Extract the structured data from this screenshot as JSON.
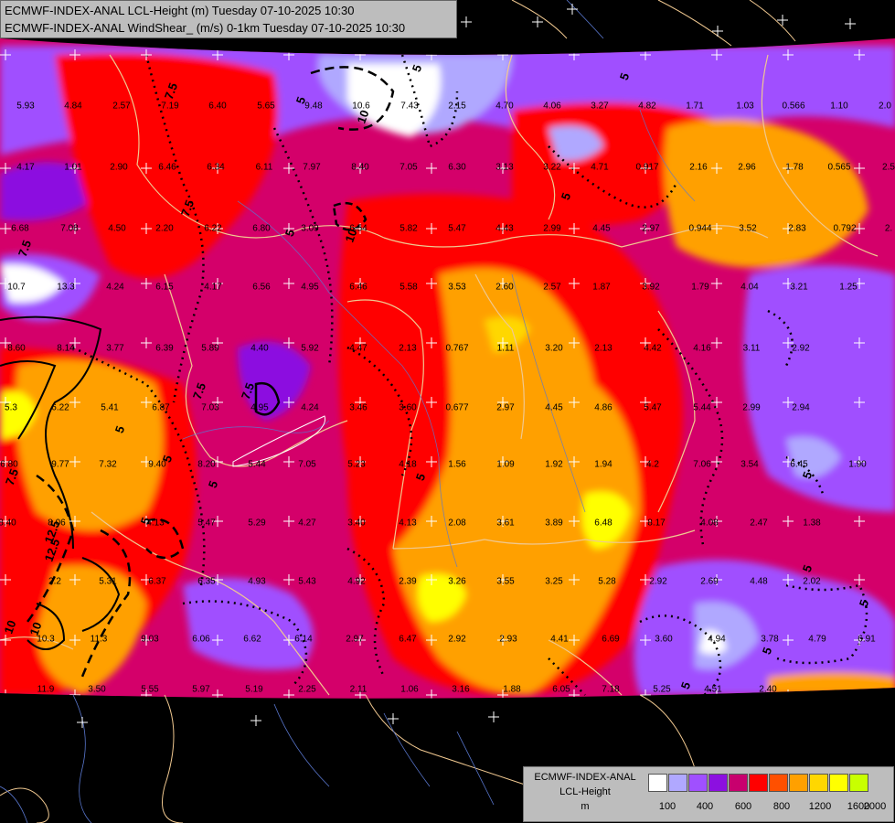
{
  "header": {
    "line1": "ECMWF-INDEX-ANAL LCL-Height (m) Tuesday 07-10-2025 10:30",
    "line2": "ECMWF-INDEX-ANAL WindShear_ (m/s) 0-1km Tuesday 07-10-2025 10:30"
  },
  "legend": {
    "line1": "ECMWF-INDEX-ANAL",
    "line2": "LCL-Height",
    "line3": "m",
    "colors": [
      "#ffffff",
      "#b0a8ff",
      "#a050ff",
      "#8c10e0",
      "#c8006e",
      "#ff0000",
      "#ff5000",
      "#ffa000",
      "#ffd700",
      "#ffff00",
      "#c8ff00",
      "#7cc800",
      "#20a040",
      "#00a880",
      "#00a0ff"
    ],
    "ticks": [
      "100",
      "400",
      "600",
      "800",
      "1200",
      "1600",
      "2000"
    ]
  },
  "contour_labels": [
    "7.5",
    "7.5",
    "5",
    "5",
    "10",
    "5",
    "5",
    "7.5",
    "5",
    "7.5",
    "5",
    "7.5",
    "5",
    "5",
    "10",
    "10",
    "12.5",
    "12.5",
    "5",
    "5",
    "5",
    "5",
    "5",
    "5",
    "7.5",
    "5",
    "10"
  ],
  "point_values": [
    "5.93",
    "4.84",
    "2.57",
    "7.19",
    "6.40",
    "5.65",
    "9.48",
    "10.6",
    "7.43",
    "2.15",
    "4.70",
    "4.06",
    "3.27",
    "4.82",
    "1.71",
    "1.03",
    "0.566",
    "1.10",
    "2.0",
    "4.17",
    "1.01",
    "2.90",
    "6.46",
    "6.34",
    "6.11",
    "7.97",
    "8.40",
    "7.05",
    "6.30",
    "3.13",
    "3.22",
    "4.71",
    "0.917",
    "2.16",
    "2.96",
    "1.78",
    "0.565",
    "2.5",
    "6.68",
    "7.08",
    "4.50",
    "2.20",
    "6.22",
    "6.80",
    "3.09",
    "6.54",
    "5.82",
    "5.47",
    "4.43",
    "2.99",
    "4.45",
    "2.97",
    "0.944",
    "3.52",
    "2.83",
    "0.792",
    "2.",
    "10.7",
    "13.3",
    "4.24",
    "6.15",
    "4.17",
    "6.56",
    "4.95",
    "6.46",
    "5.58",
    "3.53",
    "2.60",
    "2.57",
    "1.87",
    "3.92",
    "1.79",
    "4.04",
    "3.21",
    "1.25",
    "8.60",
    "8.14",
    "3.77",
    "6.39",
    "5.89",
    "4.40",
    "5.92",
    "4.47",
    "2.13",
    "0.767",
    "1.11",
    "3.20",
    "2.13",
    "4.42",
    "4.16",
    "3.11",
    "2.92",
    "5.3",
    "6.22",
    "5.41",
    "6.87",
    "7.03",
    "4.95",
    "4.24",
    "3.46",
    "3.60",
    "0.677",
    "2.97",
    "4.45",
    "4.86",
    "5.47",
    "5.44",
    "2.99",
    "2.94",
    "6.80",
    "9.77",
    "7.32",
    "9.40",
    "8.20",
    "5.44",
    "7.05",
    "5.23",
    "4.18",
    "1.56",
    "1.09",
    "1.92",
    "1.94",
    "4.2",
    "7.06",
    "3.54",
    "6.45",
    "1.90",
    "8.40",
    "8.06",
    "4.13",
    "5.47",
    "5.29",
    "4.27",
    "3.40",
    "4.13",
    "2.08",
    "3.61",
    "3.89",
    "6.48",
    "8.17",
    "4.08",
    "2.47",
    "1.38",
    "2.2",
    "5.31",
    "6.37",
    "6.35",
    "4.93",
    "5.43",
    "4.92",
    "2.39",
    "3.26",
    "3.55",
    "3.25",
    "5.28",
    "2.92",
    "2.69",
    "4.48",
    "2.02",
    "10.3",
    "11.3",
    "9.03",
    "6.06",
    "6.62",
    "6.14",
    "2.97",
    "6.47",
    "2.92",
    "2.93",
    "4.41",
    "6.69",
    "3.60",
    "4.94",
    "3.78",
    "4.79",
    "6.91",
    "11.9",
    "3.50",
    "5.55",
    "5.97",
    "5.19",
    "2.25",
    "2.11",
    "1.06",
    "3.16",
    "1.88",
    "6.05",
    "7.18",
    "5.25",
    "4.51",
    "2.40"
  ]
}
